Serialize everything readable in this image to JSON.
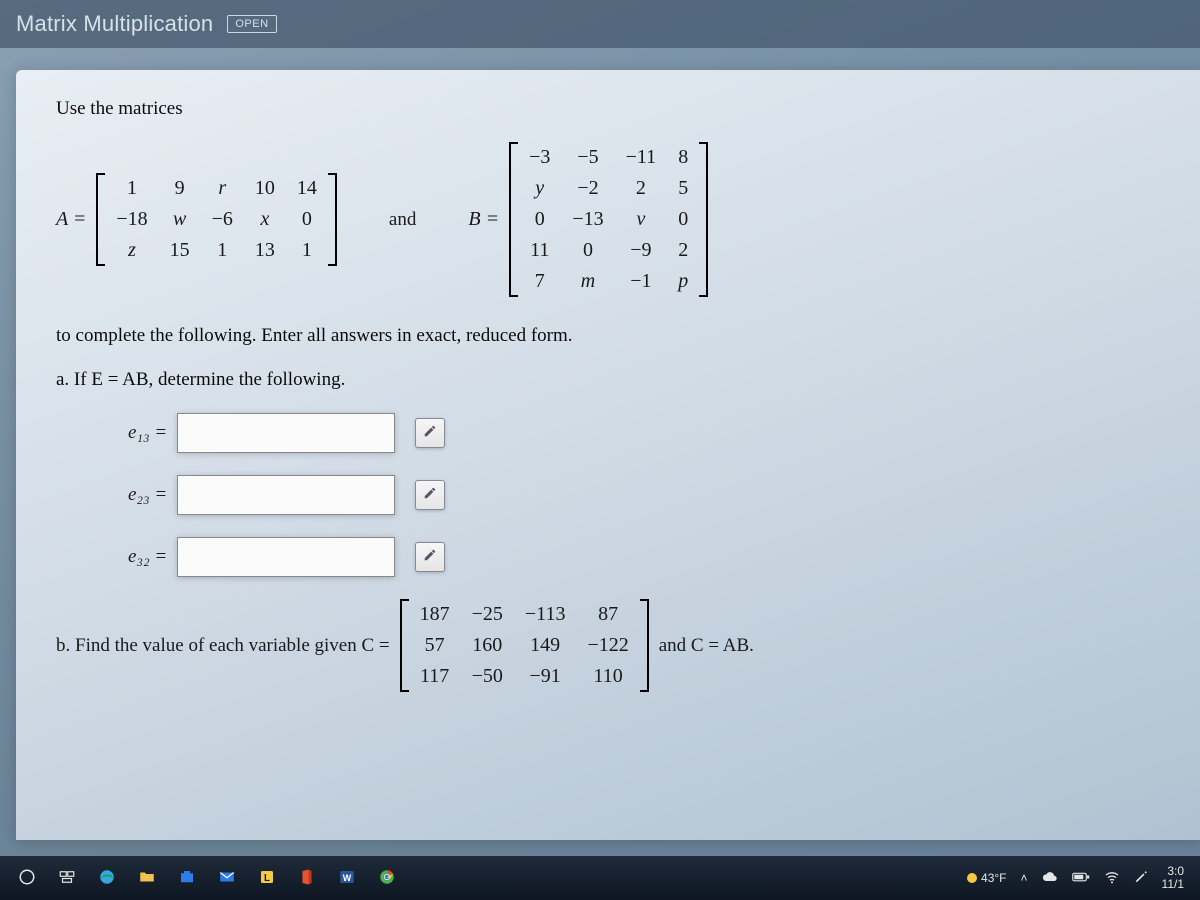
{
  "header": {
    "title": "Matrix Multiplication",
    "badge": "OPEN"
  },
  "content": {
    "intro": "Use the matrices",
    "A_label": "A =",
    "and_word": "and",
    "B_label": "B =",
    "instruct": "to complete the following. Enter all answers in exact, reduced form.",
    "part_a": "a. If E = AB, determine the following.",
    "e13_label": "e₁₃ =",
    "e23_label": "e₂₃ =",
    "e32_label": "e₃₂ =",
    "part_b_prefix": "b. Find the value of each variable given C =",
    "part_b_suffix": "and C = AB."
  },
  "matrices": {
    "A": [
      [
        "1",
        "9",
        "r",
        "10",
        "14"
      ],
      [
        "-18",
        "w",
        "-6",
        "x",
        "0"
      ],
      [
        "z",
        "15",
        "1",
        "13",
        "1"
      ]
    ],
    "B": [
      [
        "-3",
        "-5",
        "-11",
        "8"
      ],
      [
        "y",
        "-2",
        "2",
        "5"
      ],
      [
        "0",
        "-13",
        "v",
        "0"
      ],
      [
        "11",
        "0",
        "-9",
        "2"
      ],
      [
        "7",
        "m",
        "-1",
        "p"
      ]
    ],
    "C": [
      [
        "187",
        "-25",
        "-113",
        "87"
      ],
      [
        "57",
        "160",
        "149",
        "-122"
      ],
      [
        "117",
        "-50",
        "-91",
        "110"
      ]
    ]
  },
  "inputs": {
    "e13": "",
    "e23": "",
    "e32": ""
  },
  "taskbar": {
    "temp": "43°F",
    "time_top": "3:0",
    "time_bottom": "11/1"
  }
}
